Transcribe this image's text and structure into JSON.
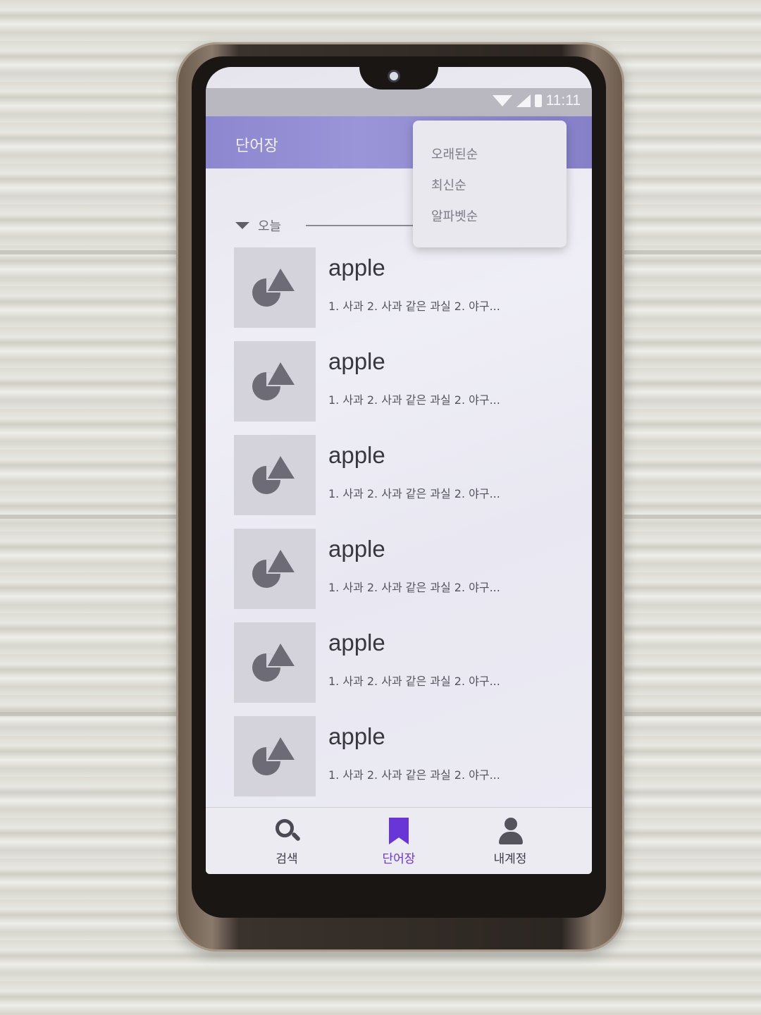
{
  "status_bar": {
    "time": "11:11"
  },
  "app_bar": {
    "title": "단어장"
  },
  "sort_menu": {
    "items": [
      "오래된순",
      "최신순",
      "알파벳순"
    ]
  },
  "section": {
    "label": "오늘"
  },
  "words": [
    {
      "word": "apple",
      "meaning": "1. 사과  2. 사과 같은 과실  2. 야구..."
    },
    {
      "word": "apple",
      "meaning": "1. 사과  2. 사과 같은 과실  2. 야구..."
    },
    {
      "word": "apple",
      "meaning": "1. 사과  2. 사과 같은 과실  2. 야구..."
    },
    {
      "word": "apple",
      "meaning": "1. 사과  2. 사과 같은 과실  2. 야구..."
    },
    {
      "word": "apple",
      "meaning": "1. 사과  2. 사과 같은 과실  2. 야구..."
    },
    {
      "word": "apple",
      "meaning": "1. 사과  2. 사과 같은 과실  2. 야구..."
    }
  ],
  "bottom_nav": {
    "items": [
      {
        "label": "검색",
        "icon": "search-icon"
      },
      {
        "label": "단어장",
        "icon": "bookmark-icon",
        "active": true
      },
      {
        "label": "내계정",
        "icon": "person-icon"
      }
    ]
  },
  "colors": {
    "accent": "#6a35d6",
    "app_bar": "#8c87cf"
  }
}
